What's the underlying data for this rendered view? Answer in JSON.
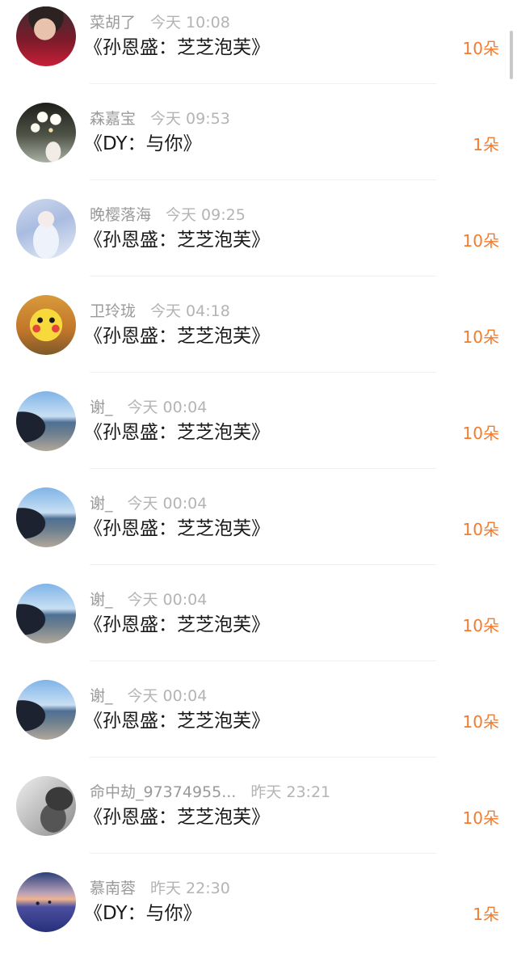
{
  "records": [
    {
      "user": "菜胡了",
      "time": "今天 10:08",
      "gift": "《孙恩盛：芝芝泡芙》",
      "amount": "10朵",
      "avatar_icon": "person-avatar-icon"
    },
    {
      "user": "森嘉宝",
      "time": "今天 09:53",
      "gift": "《DY：与你》",
      "amount": "1朵",
      "avatar_icon": "flower-avatar-icon"
    },
    {
      "user": "晚樱落海",
      "time": "今天 09:25",
      "gift": "《孙恩盛：芝芝泡芙》",
      "amount": "10朵",
      "avatar_icon": "fairy-avatar-icon"
    },
    {
      "user": "卫玲珑",
      "time": "今天 04:18",
      "gift": "《孙恩盛：芝芝泡芙》",
      "amount": "10朵",
      "avatar_icon": "pikachu-avatar-icon"
    },
    {
      "user": "谢_",
      "time": "今天 00:04",
      "gift": "《孙恩盛：芝芝泡芙》",
      "amount": "10朵",
      "avatar_icon": "beach-avatar-icon"
    },
    {
      "user": "谢_",
      "time": "今天 00:04",
      "gift": "《孙恩盛：芝芝泡芙》",
      "amount": "10朵",
      "avatar_icon": "beach-avatar-icon"
    },
    {
      "user": "谢_",
      "time": "今天 00:04",
      "gift": "《孙恩盛：芝芝泡芙》",
      "amount": "10朵",
      "avatar_icon": "beach-avatar-icon"
    },
    {
      "user": "谢_",
      "time": "今天 00:04",
      "gift": "《孙恩盛：芝芝泡芙》",
      "amount": "10朵",
      "avatar_icon": "beach-avatar-icon"
    },
    {
      "user": "命中劫_97374955...",
      "time": "昨天 23:21",
      "gift": "《孙恩盛：芝芝泡芙》",
      "amount": "10朵",
      "avatar_icon": "portrait-avatar-icon"
    },
    {
      "user": "慕南蓉",
      "time": "昨天 22:30",
      "gift": "《DY：与你》",
      "amount": "1朵",
      "avatar_icon": "sunset-avatar-icon"
    }
  ],
  "colors": {
    "amount": "#f57b2c",
    "username": "#9a9a9a",
    "time": "#b4b4b4",
    "title": "#1a1a1a",
    "divider": "#efefef"
  }
}
